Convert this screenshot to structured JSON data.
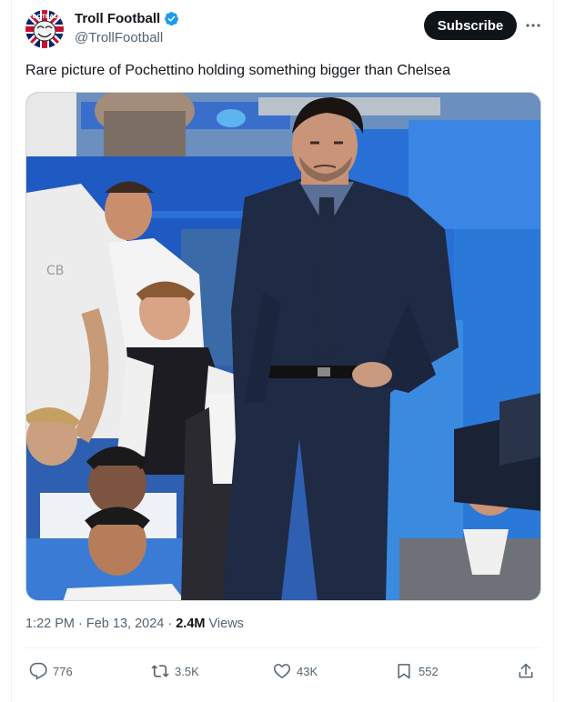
{
  "author": {
    "name": "Troll Football",
    "handle": "@TrollFootball",
    "avatar_icon": "union-jack-troll-face-icon",
    "verified_icon": "verified-badge-icon"
  },
  "subscribe_label": "Subscribe",
  "more_icon": "more-dots-icon",
  "tweet_text": "Rare picture of Pochettino holding something bigger than Chelsea",
  "photo": {
    "description_icon": "stadium-photo",
    "shirt_text": "CB"
  },
  "meta": {
    "timestamp": "1:22 PM · Feb 13, 2024 · ",
    "views_count": "2.4M",
    "views_label": " Views"
  },
  "actions": {
    "replies": "776",
    "reposts": "3.5K",
    "likes": "43K",
    "bookmarks": "552"
  },
  "colors": {
    "accent": "#1d9bf0",
    "text": "#0f1419",
    "muted": "#536471",
    "button_bg": "#0f1419"
  }
}
